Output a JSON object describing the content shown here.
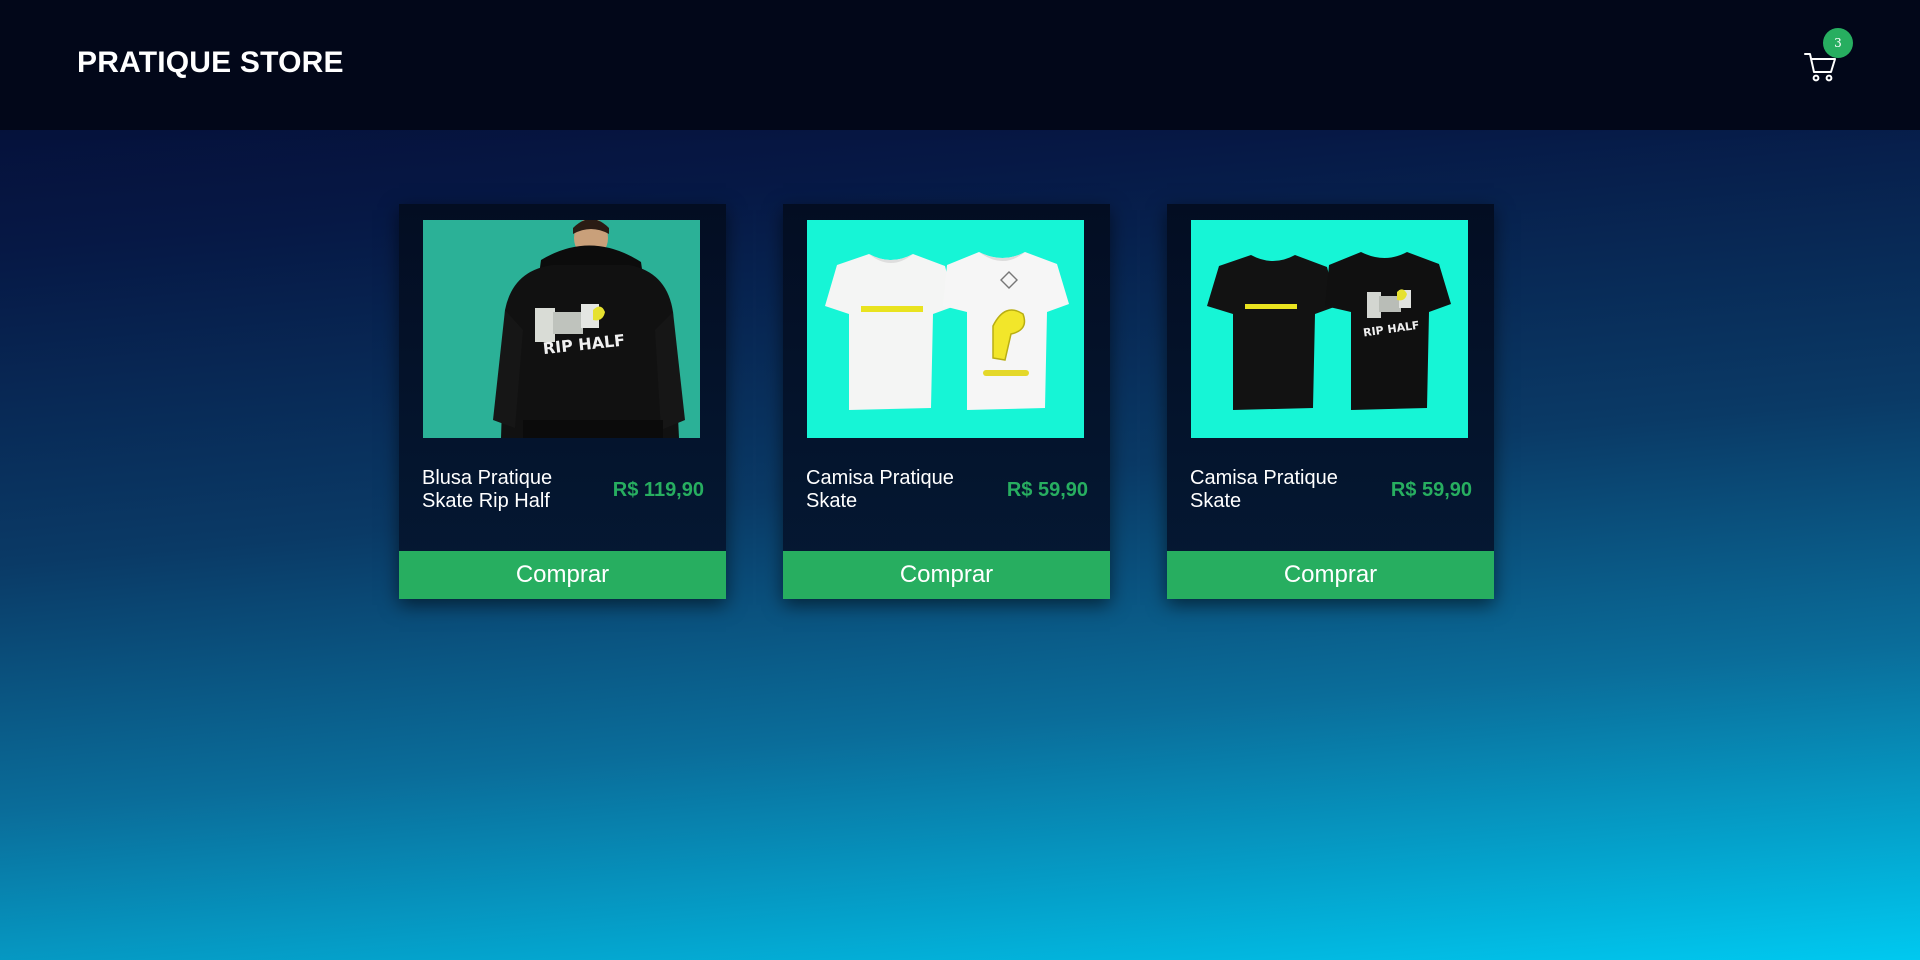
{
  "header": {
    "store_name": "PRATIQUE STORE",
    "cart_icon": "shopping-cart-icon",
    "cart_count": "3"
  },
  "products": [
    {
      "name": "Blusa Pratique Skate Rip Half",
      "price": "R$ 119,90",
      "button_label": "Comprar",
      "image": "black-hoodie-rip-half-photo"
    },
    {
      "name": "Camisa Pratique Skate",
      "price": "R$ 59,90",
      "button_label": "Comprar",
      "image": "white-tshirts-photo"
    },
    {
      "name": "Camisa Pratique Skate",
      "price": "R$ 59,90",
      "button_label": "Comprar",
      "image": "black-tshirts-photo"
    }
  ],
  "colors": {
    "accent": "#27ae60",
    "header_bg": "#020719",
    "card_bg": "#030d22"
  }
}
